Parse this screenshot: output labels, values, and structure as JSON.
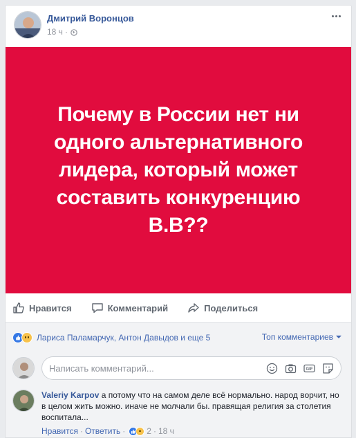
{
  "post": {
    "author_name": "Дмитрий Воронцов",
    "time": "18 ч",
    "meta_separator": "·",
    "image_text": "Почему в России нет ни одного альтернативного лидера, который может составить конкуренцию В.В??",
    "image_bg_color": "#e10c3e"
  },
  "actions": {
    "like_label": "Нравится",
    "comment_label": "Комментарий",
    "share_label": "Поделиться"
  },
  "reactions": {
    "summary": "Лариса Паламарчук, Антон Давыдов и еще 5",
    "sort_label": "Топ комментариев",
    "icons": [
      "like-icon",
      "sad-icon"
    ]
  },
  "composer": {
    "placeholder": "Написать комментарий...",
    "icons": [
      "emoji-icon",
      "camera-icon",
      "gif-icon",
      "sticker-icon"
    ]
  },
  "comment": {
    "author": "Valeriy Karpov",
    "text": " а потому что на самом деле всё нормально. народ ворчит, но в целом жить можно. иначе не молчали бы. правящая религия за столетия воспитала...",
    "like_label": "Нравится",
    "reply_label": "Ответить",
    "sep": "·",
    "reaction_count": "2",
    "time": "18 ч"
  },
  "colors": {
    "link_blue": "#4267b2",
    "name_blue": "#365899",
    "muted": "#90949c"
  }
}
